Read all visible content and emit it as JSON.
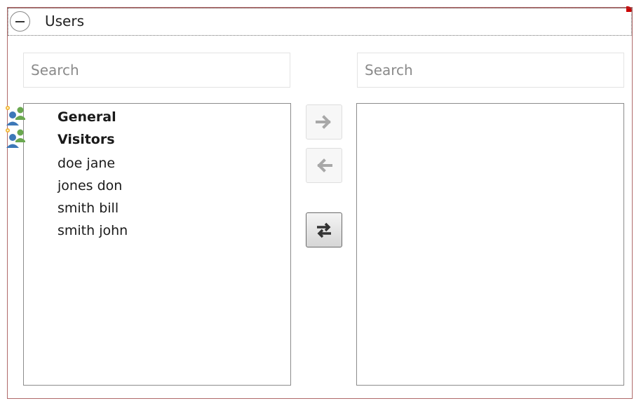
{
  "group": {
    "title": "Users",
    "collapse_icon": "minus-circle-icon"
  },
  "available": {
    "search_placeholder": "Search",
    "items": [
      {
        "label": "General",
        "kind": "group",
        "icon": "user-group-icon"
      },
      {
        "label": "Visitors",
        "kind": "group",
        "icon": "user-group-icon"
      },
      {
        "label": "doe jane",
        "kind": "user"
      },
      {
        "label": "jones don",
        "kind": "user"
      },
      {
        "label": "smith bill",
        "kind": "user"
      },
      {
        "label": "smith john",
        "kind": "user"
      }
    ]
  },
  "selected": {
    "search_placeholder": "Search",
    "items": []
  },
  "actions": {
    "add": {
      "icon": "arrow-right-icon",
      "enabled": false
    },
    "remove": {
      "icon": "arrow-left-icon",
      "enabled": false
    },
    "swap": {
      "icon": "swap-arrows-icon",
      "enabled": true
    }
  },
  "colors": {
    "frame_border": "#b06a6a",
    "corner_marker": "#cc0000",
    "disabled_arrow": "#a8a8a8",
    "active_arrow": "#333333"
  }
}
